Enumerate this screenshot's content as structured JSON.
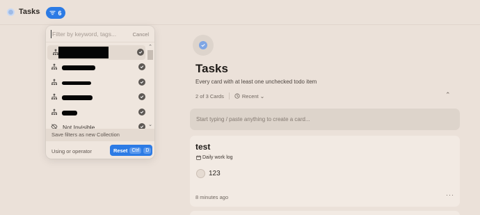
{
  "topbar": {
    "app_title": "Tasks",
    "filter_count": "6"
  },
  "filter_popover": {
    "search_placeholder": "Filter by keyword, tags...",
    "cancel_label": "Cancel",
    "items": [
      {
        "label": "",
        "redacted": true,
        "checked": true
      },
      {
        "label": "",
        "redacted": true,
        "checked": true
      },
      {
        "label": "",
        "redacted": true,
        "checked": true
      },
      {
        "label": "",
        "redacted": true,
        "checked": true
      },
      {
        "label": "",
        "redacted": true,
        "checked": true
      },
      {
        "label": "Not Invisible",
        "redacted": false,
        "checked": true
      }
    ],
    "save_label": "Save filters as new Collection",
    "operator_label": "Using or operator",
    "reset_label": "Reset",
    "shortcut_key1": "Ctrl",
    "shortcut_key2": "D"
  },
  "main": {
    "title": "Tasks",
    "subtitle": "Every card with at least one unchecked todo item",
    "card_count": "2 of 3 Cards",
    "sort_label": "Recent",
    "composer_placeholder": "Start typing / paste anything to create a card...",
    "cards": [
      {
        "title": "test",
        "tag": "Daily work log",
        "todo": "123",
        "time": "8 minutes ago"
      }
    ]
  },
  "colors": {
    "background": "#ebe1d9",
    "accent": "#2c7be5",
    "card": "#f2eae3"
  }
}
